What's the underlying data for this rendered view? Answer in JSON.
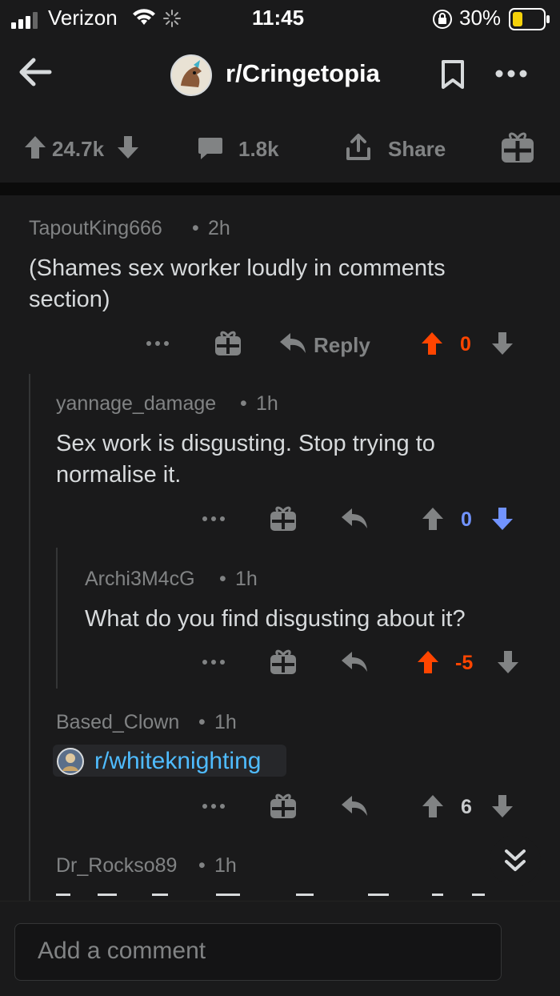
{
  "status_bar": {
    "carrier": "Verizon",
    "time": "11:45",
    "battery": "30%"
  },
  "header": {
    "subreddit": "r/Cringetopia"
  },
  "post_actions": {
    "upvotes": "24.7k",
    "comments": "1.8k",
    "share_label": "Share"
  },
  "comments": [
    {
      "author": "TapoutKing666",
      "age": "2h",
      "text_line1": "(Shames sex worker loudly in comments",
      "text_line2": "section)",
      "reply_label": "Reply",
      "score": "0",
      "vote_state": "up"
    },
    {
      "author": "yannage_damage",
      "age": "1h",
      "text_line1": "Sex work is disgusting. Stop trying to",
      "text_line2": "normalise it.",
      "score": "0",
      "vote_state": "down"
    },
    {
      "author": "Archi3M4cG",
      "age": "1h",
      "text_line1": "What do you find disgusting about it?",
      "score": "-5",
      "vote_state": "up"
    },
    {
      "author": "Based_Clown",
      "age": "1h",
      "link_text": "r/whiteknighting",
      "score": "6",
      "vote_state": "none"
    },
    {
      "author": "Dr_Rockso89",
      "age": "1h"
    }
  ],
  "composer": {
    "placeholder": "Add a comment"
  },
  "colors": {
    "background": "#1a1a1b",
    "upvote": "#ff4500",
    "downvote": "#7193ff",
    "link": "#4fbcff",
    "muted": "#818384"
  }
}
